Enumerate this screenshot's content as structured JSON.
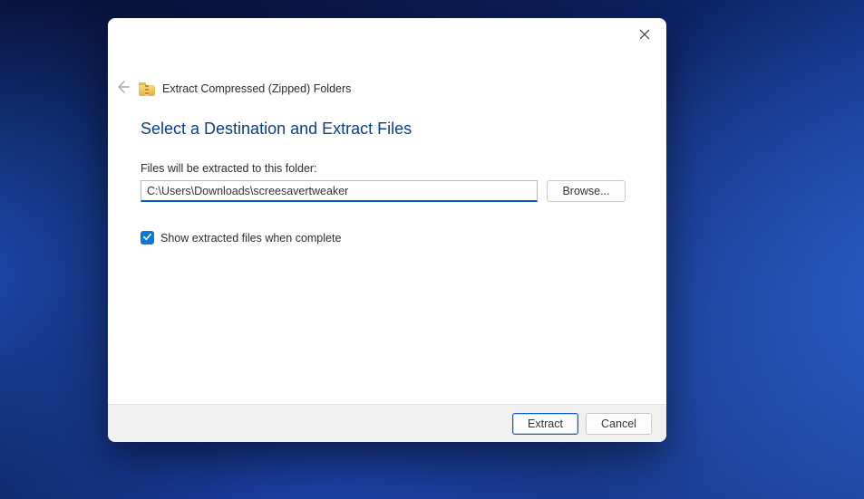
{
  "dialog": {
    "title": "Extract Compressed (Zipped) Folders",
    "heading": "Select a Destination and Extract Files",
    "path_label": "Files will be extracted to this folder:",
    "path_value": "C:\\Users\\Downloads\\screesavertweaker",
    "browse_label": "Browse...",
    "show_files": {
      "checked": true,
      "label": "Show extracted files when complete"
    },
    "buttons": {
      "extract": "Extract",
      "cancel": "Cancel"
    }
  }
}
